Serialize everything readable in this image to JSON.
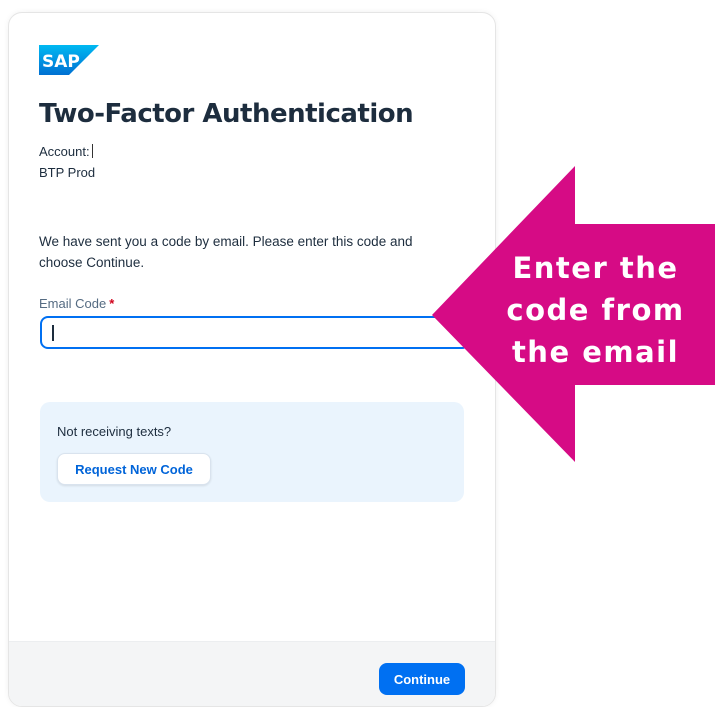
{
  "brand": {
    "logo_text": "SAP"
  },
  "header": {
    "title": "Two-Factor Authentication",
    "account_label": "Account:",
    "account_value": "BTP Prod"
  },
  "form": {
    "description": "We have sent you a code by email. Please enter this code and choose Continue.",
    "email_code_label": "Email Code",
    "required_marker": "*",
    "email_code_value": ""
  },
  "help_box": {
    "text": "Not receiving texts?",
    "request_button": "Request New Code"
  },
  "footer": {
    "continue_button": "Continue"
  },
  "annotation": {
    "lines": [
      "Enter the",
      "code from",
      "the email"
    ],
    "color": "#d60b85"
  },
  "colors": {
    "primary": "#0070f2",
    "link": "#0064d9",
    "info_bg": "#eaf4fd",
    "required": "#d0021b"
  }
}
